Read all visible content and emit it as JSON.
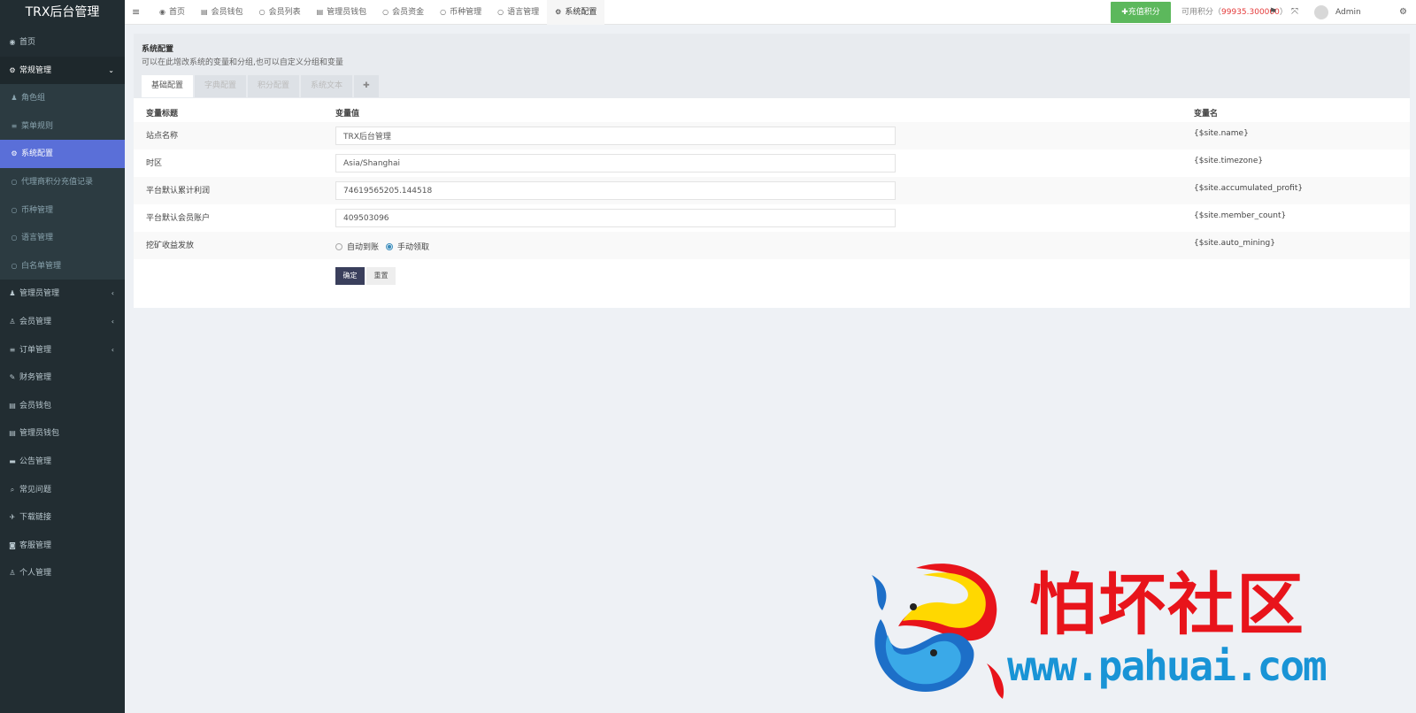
{
  "app": {
    "logo": "TRX后台管理"
  },
  "sidebar": {
    "items": [
      {
        "label": "首页",
        "icon": "dashboard-icon",
        "glyph": "◉",
        "type": "top"
      },
      {
        "label": "常规管理",
        "icon": "cogs-icon",
        "glyph": "⚙",
        "type": "open",
        "arrow": "⌄"
      },
      {
        "label": "角色组",
        "icon": "group-icon",
        "glyph": "♟",
        "type": "sub"
      },
      {
        "label": "菜单规则",
        "icon": "bars-icon",
        "glyph": "≡",
        "type": "sub"
      },
      {
        "label": "系统配置",
        "icon": "gear-icon",
        "glyph": "⚙",
        "type": "sub-active"
      },
      {
        "label": "代理商积分充值记录",
        "icon": "circle-icon",
        "glyph": "○",
        "type": "sub"
      },
      {
        "label": "币种管理",
        "icon": "circle-icon",
        "glyph": "○",
        "type": "sub"
      },
      {
        "label": "语言管理",
        "icon": "circle-icon",
        "glyph": "○",
        "type": "sub"
      },
      {
        "label": "白名单管理",
        "icon": "circle-icon",
        "glyph": "○",
        "type": "sub"
      },
      {
        "label": "管理员管理",
        "icon": "users-icon",
        "glyph": "♟",
        "type": "top",
        "arrow": "‹"
      },
      {
        "label": "会员管理",
        "icon": "user-icon",
        "glyph": "♙",
        "type": "top",
        "arrow": "‹"
      },
      {
        "label": "订单管理",
        "icon": "list-icon",
        "glyph": "≡",
        "type": "top",
        "arrow": "‹"
      },
      {
        "label": "财务管理",
        "icon": "edit-icon",
        "glyph": "✎",
        "type": "top"
      },
      {
        "label": "会员钱包",
        "icon": "table-icon",
        "glyph": "▤",
        "type": "top"
      },
      {
        "label": "管理员钱包",
        "icon": "table-icon",
        "glyph": "▤",
        "type": "top"
      },
      {
        "label": "公告管理",
        "icon": "card-icon",
        "glyph": "▬",
        "type": "top"
      },
      {
        "label": "常见问题",
        "icon": "search-icon",
        "glyph": "⌕",
        "type": "top"
      },
      {
        "label": "下载链接",
        "icon": "plane-icon",
        "glyph": "✈",
        "type": "top"
      },
      {
        "label": "客服管理",
        "icon": "chat-icon",
        "glyph": "◙",
        "type": "top"
      },
      {
        "label": "个人管理",
        "icon": "user-icon",
        "glyph": "♙",
        "type": "top"
      }
    ]
  },
  "topbar": {
    "menu_glyph": "≡",
    "tabs": [
      {
        "label": "首页",
        "glyph": "◉",
        "icon": "dashboard-icon"
      },
      {
        "label": "会员钱包",
        "glyph": "▤",
        "icon": "table-icon"
      },
      {
        "label": "会员列表",
        "glyph": "○",
        "icon": "circle-icon"
      },
      {
        "label": "管理员钱包",
        "glyph": "▤",
        "icon": "table-icon"
      },
      {
        "label": "会员资金",
        "glyph": "○",
        "icon": "circle-icon"
      },
      {
        "label": "币种管理",
        "glyph": "○",
        "icon": "circle-icon"
      },
      {
        "label": "语言管理",
        "glyph": "○",
        "icon": "circle-icon"
      },
      {
        "label": "系统配置",
        "glyph": "⚙",
        "icon": "gear-icon",
        "active": true
      }
    ],
    "recharge_label": "✚充值积分",
    "balance_label": "可用积分（",
    "balance_amount": "99935.300000",
    "balance_close": "）",
    "user": "Admin",
    "tool_glyphs": {
      "flag": "⚑",
      "fullscreen": "⤧",
      "cog": "⚙"
    }
  },
  "config": {
    "title": "系统配置",
    "subtitle": "可以在此增改系统的变量和分组,也可以自定义分组和变量",
    "tabs": [
      "基础配置",
      "字典配置",
      "积分配置",
      "系统文本",
      "✚"
    ],
    "headers": {
      "title": "变量标题",
      "value": "变量值",
      "name": "变量名"
    },
    "rows": [
      {
        "title": "站点名称",
        "value": "TRX后台管理",
        "name": "{$site.name}"
      },
      {
        "title": "时区",
        "value": "Asia/Shanghai",
        "name": "{$site.timezone}"
      },
      {
        "title": "平台默认累计利润",
        "value": "74619565205.144518",
        "name": "{$site.accumulated_profit}"
      },
      {
        "title": "平台默认会员账户",
        "value": "409503096",
        "name": "{$site.member_count}"
      }
    ],
    "radio_row": {
      "title": "挖矿收益发放",
      "options": [
        "自动到账",
        "手动领取"
      ],
      "selected": "手动领取",
      "name": "{$site.auto_mining}"
    },
    "submit_label": "确定",
    "reset_label": "重置"
  },
  "watermark": {
    "title": "怕坏社区",
    "url": "www.pahuai.com"
  }
}
